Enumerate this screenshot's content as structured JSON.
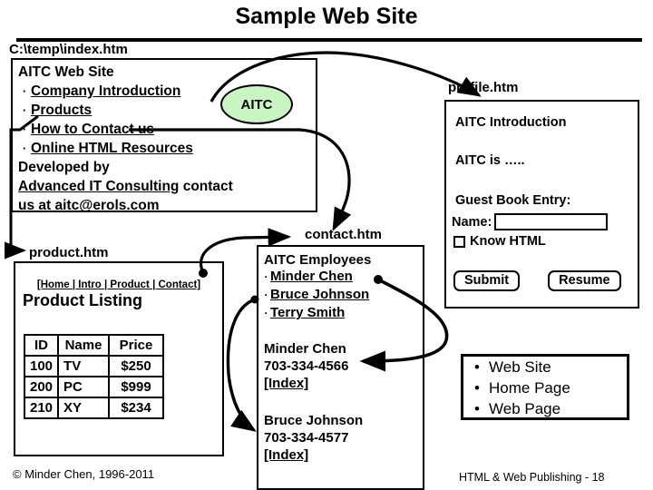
{
  "slide": {
    "title": "Sample Web Site",
    "footer_right": "HTML & Web Publishing - 18",
    "copyright": "© Minder Chen, 1996-2011"
  },
  "colors": {
    "accent_ellipse": "#c9f5c2",
    "line": "#000000",
    "background": "#ffffff"
  },
  "index_page": {
    "file_label": "C:\\temp\\index.htm",
    "heading": "AITC Web Site",
    "links": [
      "Company Introduction",
      "Products",
      "How to Contact us",
      "Online HTML Resources"
    ],
    "developed_by": "Developed by",
    "company_link": "Advanced IT Consulting",
    "contact_text": "contact",
    "us_at": "us at",
    "email": "aitc@erols.com",
    "logo_label": "AITC"
  },
  "profile_page": {
    "file_label": "profile.htm",
    "heading": "AITC Introduction",
    "body": "AITC is …..",
    "guest_book_heading": "Guest Book Entry:",
    "name_label": "Name:",
    "name_value": "",
    "name_placeholder": "",
    "checkbox_label": "Know HTML",
    "checkbox_checked": false,
    "submit_label": "Submit",
    "resume_label": "Resume"
  },
  "product_page": {
    "file_label": "product.htm",
    "nav": "[Home | Intro | Product | Contact]",
    "nav_items": [
      "[Home ",
      "| Intro ",
      "| Product ",
      "| Contact]"
    ],
    "heading": "Product Listing",
    "table": {
      "columns": [
        "ID",
        "Name",
        "Price"
      ],
      "rows": [
        [
          "100",
          "TV",
          "$250"
        ],
        [
          "200",
          "PC",
          "$999"
        ],
        [
          "210",
          "XY",
          "$234"
        ]
      ]
    }
  },
  "contact_page": {
    "file_label": "contact.htm",
    "heading": "AITC Employees",
    "employee_links": [
      "Minder Chen",
      "Bruce Johnson",
      "Terry Smith"
    ],
    "entries": [
      {
        "name": "Minder Chen",
        "phone": "703-334-4566",
        "index_link": "[Index]"
      },
      {
        "name": "Bruce Johnson",
        "phone": "703-334-4577",
        "index_link": "[Index]"
      }
    ]
  },
  "concepts_box": {
    "items": [
      "Web Site",
      "Home Page",
      "Web Page"
    ]
  }
}
